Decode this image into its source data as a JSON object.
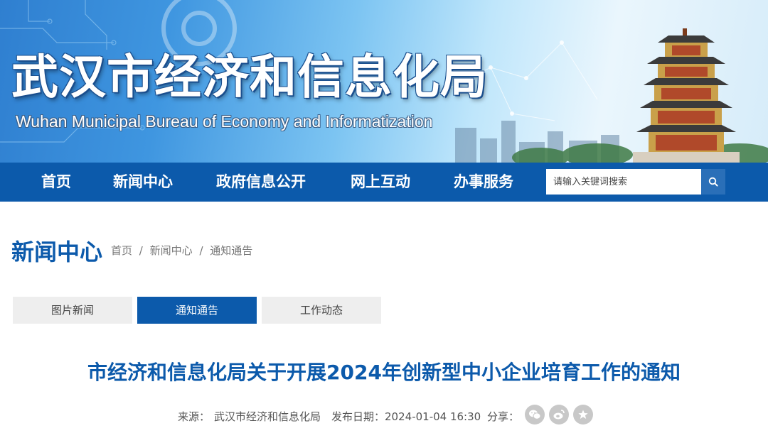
{
  "banner": {
    "title_cn": "武汉市经济和信息化局",
    "title_en": "Wuhan Municipal Bureau of Economy and Informatization"
  },
  "nav": {
    "items": [
      {
        "label": "首页"
      },
      {
        "label": "新闻中心"
      },
      {
        "label": "政府信息公开"
      },
      {
        "label": "网上互动"
      },
      {
        "label": "办事服务"
      }
    ],
    "search_placeholder": "请输入关键词搜索",
    "search_icon": "search-icon"
  },
  "section": {
    "title": "新闻中心",
    "breadcrumb": [
      "首页",
      "新闻中心",
      "通知通告"
    ],
    "separator": "/"
  },
  "tabs": [
    {
      "label": "图片新闻",
      "active": false
    },
    {
      "label": "通知通告",
      "active": true
    },
    {
      "label": "工作动态",
      "active": false
    }
  ],
  "article": {
    "title": "市经济和信息化局关于开展2024年创新型中小企业培育工作的通知",
    "source_label": "来源：",
    "source_value": "武汉市经济和信息化局",
    "date_label": "发布日期：",
    "date_value": "2024-01-04 16:30",
    "share_label": "分享：",
    "share_icons": [
      "wechat-icon",
      "weibo-icon",
      "favorite-icon"
    ]
  },
  "colors": {
    "primary": "#0c5aab",
    "tab_inactive": "#eeeeee",
    "share_icon_bg": "#c8c8c8"
  }
}
